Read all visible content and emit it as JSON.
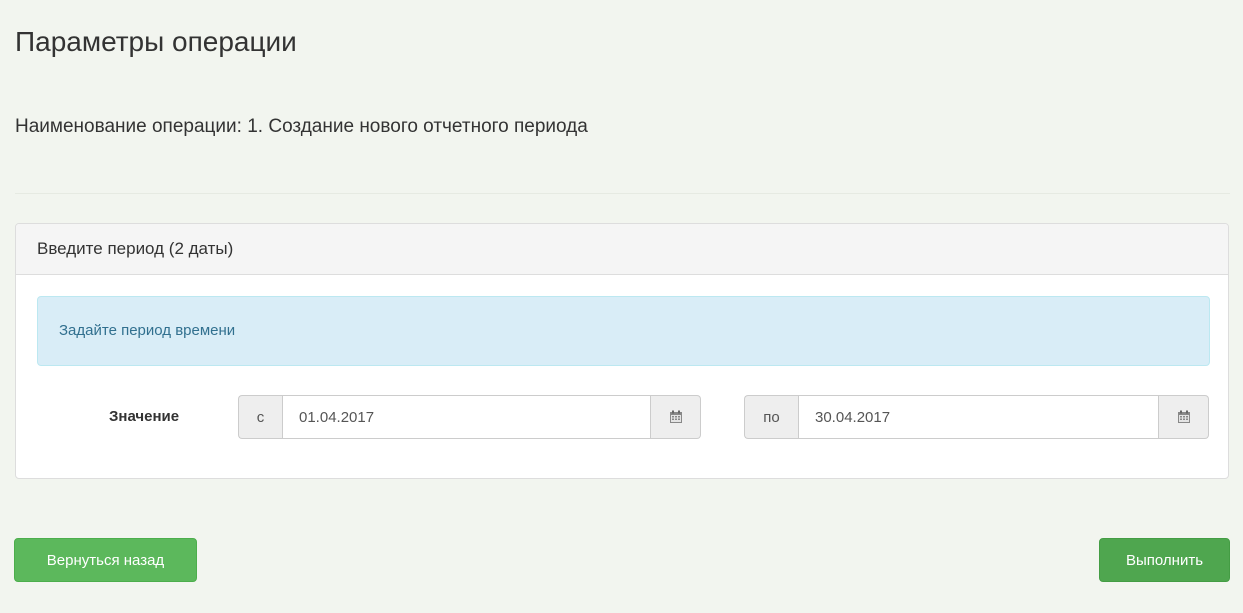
{
  "page": {
    "title": "Параметры операции"
  },
  "operation": {
    "label": "Наименование операции:",
    "value": "1. Создание нового отчетного периода"
  },
  "panel": {
    "heading": "Введите период (2 даты)",
    "alert_text": "Задайте период времени",
    "field_label": "Значение",
    "from": {
      "prefix": "с",
      "value": "01.04.2017",
      "icon": "calendar-icon"
    },
    "to": {
      "prefix": "по",
      "value": "30.04.2017",
      "icon": "calendar-icon"
    }
  },
  "buttons": {
    "back_label": "Вернуться назад",
    "run_label": "Выполнить"
  },
  "colors": {
    "button_green": "#5cb85c",
    "alert_bg": "#d9edf7",
    "alert_text": "#31708f",
    "page_bg": "#f2f5ef"
  }
}
